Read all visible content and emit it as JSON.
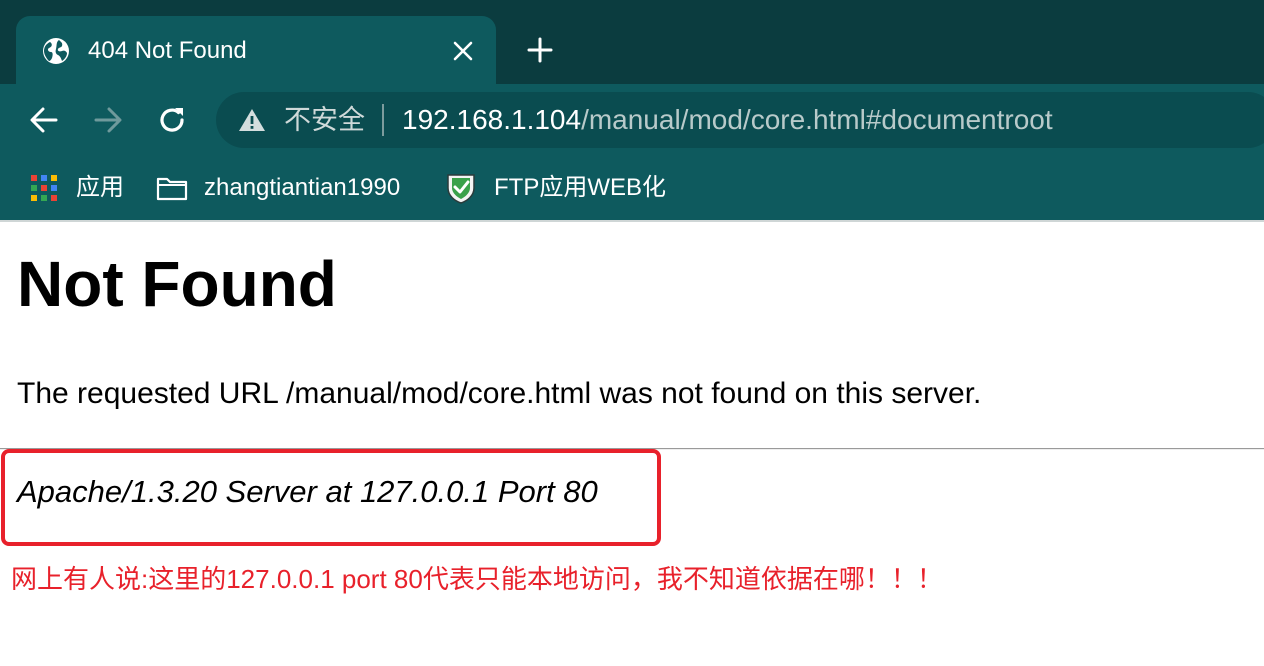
{
  "browser": {
    "tab": {
      "title": "404 Not Found"
    },
    "address_bar": {
      "security_label": "不安全",
      "url_host": "192.168.1.104",
      "url_path": "/manual/mod/core.html#documentroot"
    },
    "bookmarks": [
      {
        "label": "应用",
        "icon": "apps-grid-icon"
      },
      {
        "label": "zhangtiantian1990",
        "icon": "folder-icon"
      },
      {
        "label": "FTP应用WEB化",
        "icon": "shield-check-icon"
      }
    ],
    "colors": {
      "frame": "#0b3c3f",
      "toolbar": "#0e5a5e",
      "omnibox": "#0a4c50"
    }
  },
  "page": {
    "title": "Not Found",
    "message": "The requested URL /manual/mod/core.html was not found on this server.",
    "server_signature": "Apache/1.3.20 Server at 127.0.0.1 Port 80"
  },
  "annotation": {
    "text": "网上有人说:这里的127.0.0.1 port 80代表只能本地访问，我不知道依据在哪！！！",
    "color": "#e8212b"
  }
}
